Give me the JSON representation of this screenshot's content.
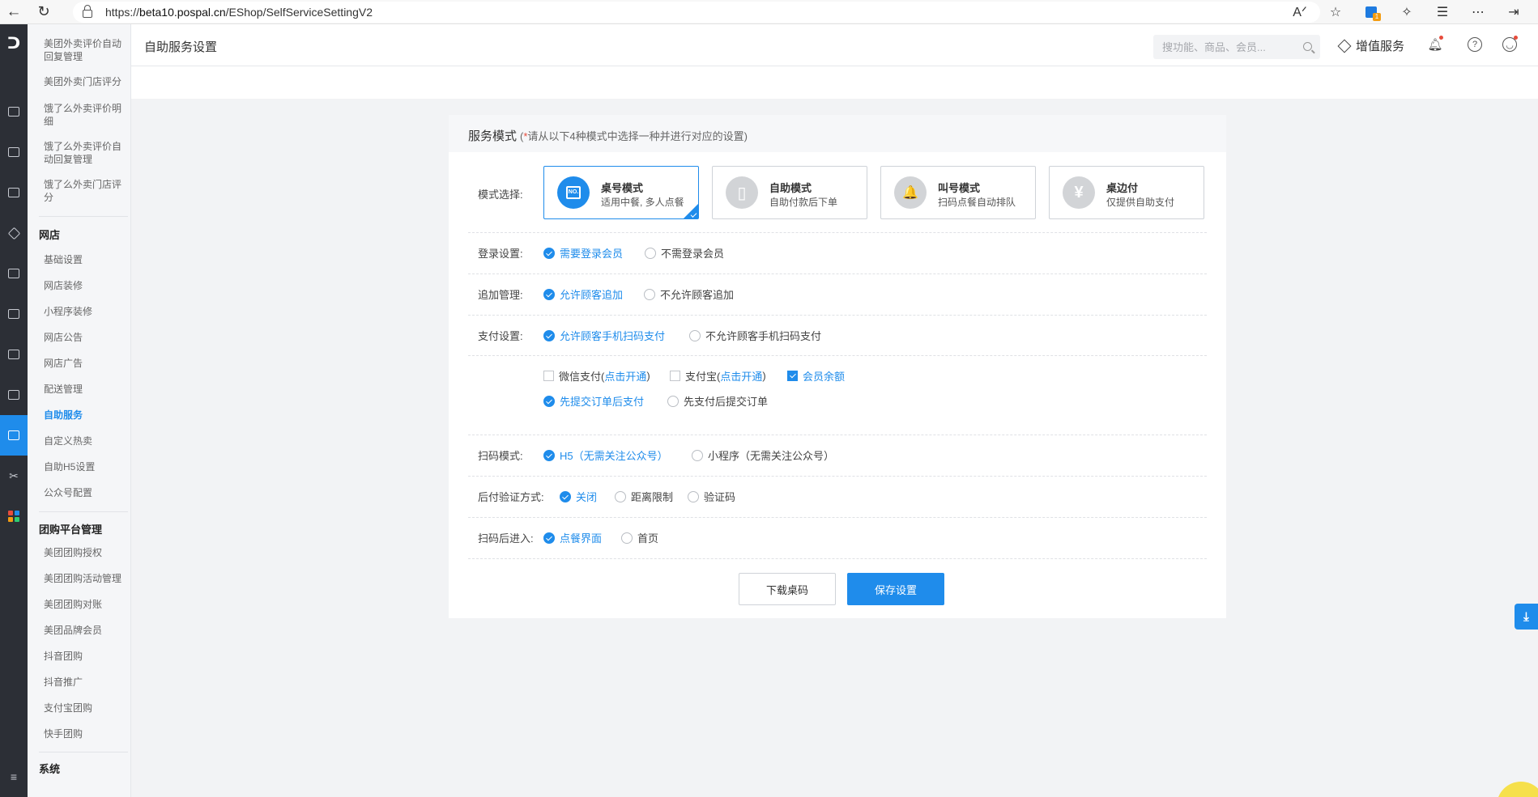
{
  "browser": {
    "url_prefix": "https://",
    "url_host": "beta10.pospal.cn",
    "url_path": "/EShop/SelfServiceSettingV2",
    "extension_badge": "1"
  },
  "sidebar": {
    "items_top": [
      "美团外卖评价自动回复管理",
      "美团外卖门店评分",
      "饿了么外卖评价明细",
      "饿了么外卖评价自动回复管理",
      "饿了么外卖门店评分"
    ],
    "shop_heading": "网店",
    "shop_items": [
      "基础设置",
      "网店装修",
      "小程序装修",
      "网店公告",
      "网店广告",
      "配送管理",
      "自助服务",
      "自定义热卖",
      "自助H5设置",
      "公众号配置"
    ],
    "group_heading": "团购平台管理",
    "group_items": [
      "美团团购授权",
      "美团团购活动管理",
      "美团团购对账",
      "美团品牌会员",
      "抖音团购",
      "抖音推广",
      "支付宝团购",
      "快手团购"
    ],
    "system_heading": "系统"
  },
  "header": {
    "title": "自助服务设置",
    "search_placeholder": "搜功能、商品、会员...",
    "value_added": "增值服务"
  },
  "card": {
    "title": "服务模式",
    "hint_star": "*",
    "hint": "请从以下4种模式中选择一种并进行对应的设置)",
    "hint_open": "(",
    "mode_label": "模式选择:",
    "modes": [
      {
        "name": "桌号模式",
        "desc": "适用中餐, 多人点餐",
        "glyph": "NO."
      },
      {
        "name": "自助模式",
        "desc": "自助付款后下单",
        "glyph": "▯"
      },
      {
        "name": "叫号模式",
        "desc": "扫码点餐自动排队",
        "glyph": "🔔"
      },
      {
        "name": "桌边付",
        "desc": "仅提供自助支付",
        "glyph": "¥"
      }
    ],
    "login": {
      "label": "登录设置:",
      "opt1": "需要登录会员",
      "opt2": "不需登录会员"
    },
    "append": {
      "label": "追加管理:",
      "opt1": "允许顾客追加",
      "opt2": "不允许顾客追加"
    },
    "pay": {
      "label": "支付设置:",
      "opt1": "允许顾客手机扫码支付",
      "opt2": "不允许顾客手机扫码支付",
      "wechat": "微信支付(",
      "wechat_link": "点击开通",
      "close_paren": ")",
      "alipay": "支付宝(",
      "alipay_link": "点击开通",
      "member": "会员余额",
      "order1": "先提交订单后支付",
      "order2": "先支付后提交订单"
    },
    "scan": {
      "label": "扫码模式:",
      "opt1": "H5（无需关注公众号）",
      "opt2": "小程序（无需关注公众号）"
    },
    "verify": {
      "label": "后付验证方式:",
      "opt1": "关闭",
      "opt2": "距离限制",
      "opt3": "验证码"
    },
    "enter": {
      "label": "扫码后进入:",
      "opt1": "点餐界面",
      "opt2": "首页"
    },
    "btn_download": "下载桌码",
    "btn_save": "保存设置"
  },
  "colors": {
    "accent": "#1f8ceb",
    "rail": "#2c2f36"
  }
}
